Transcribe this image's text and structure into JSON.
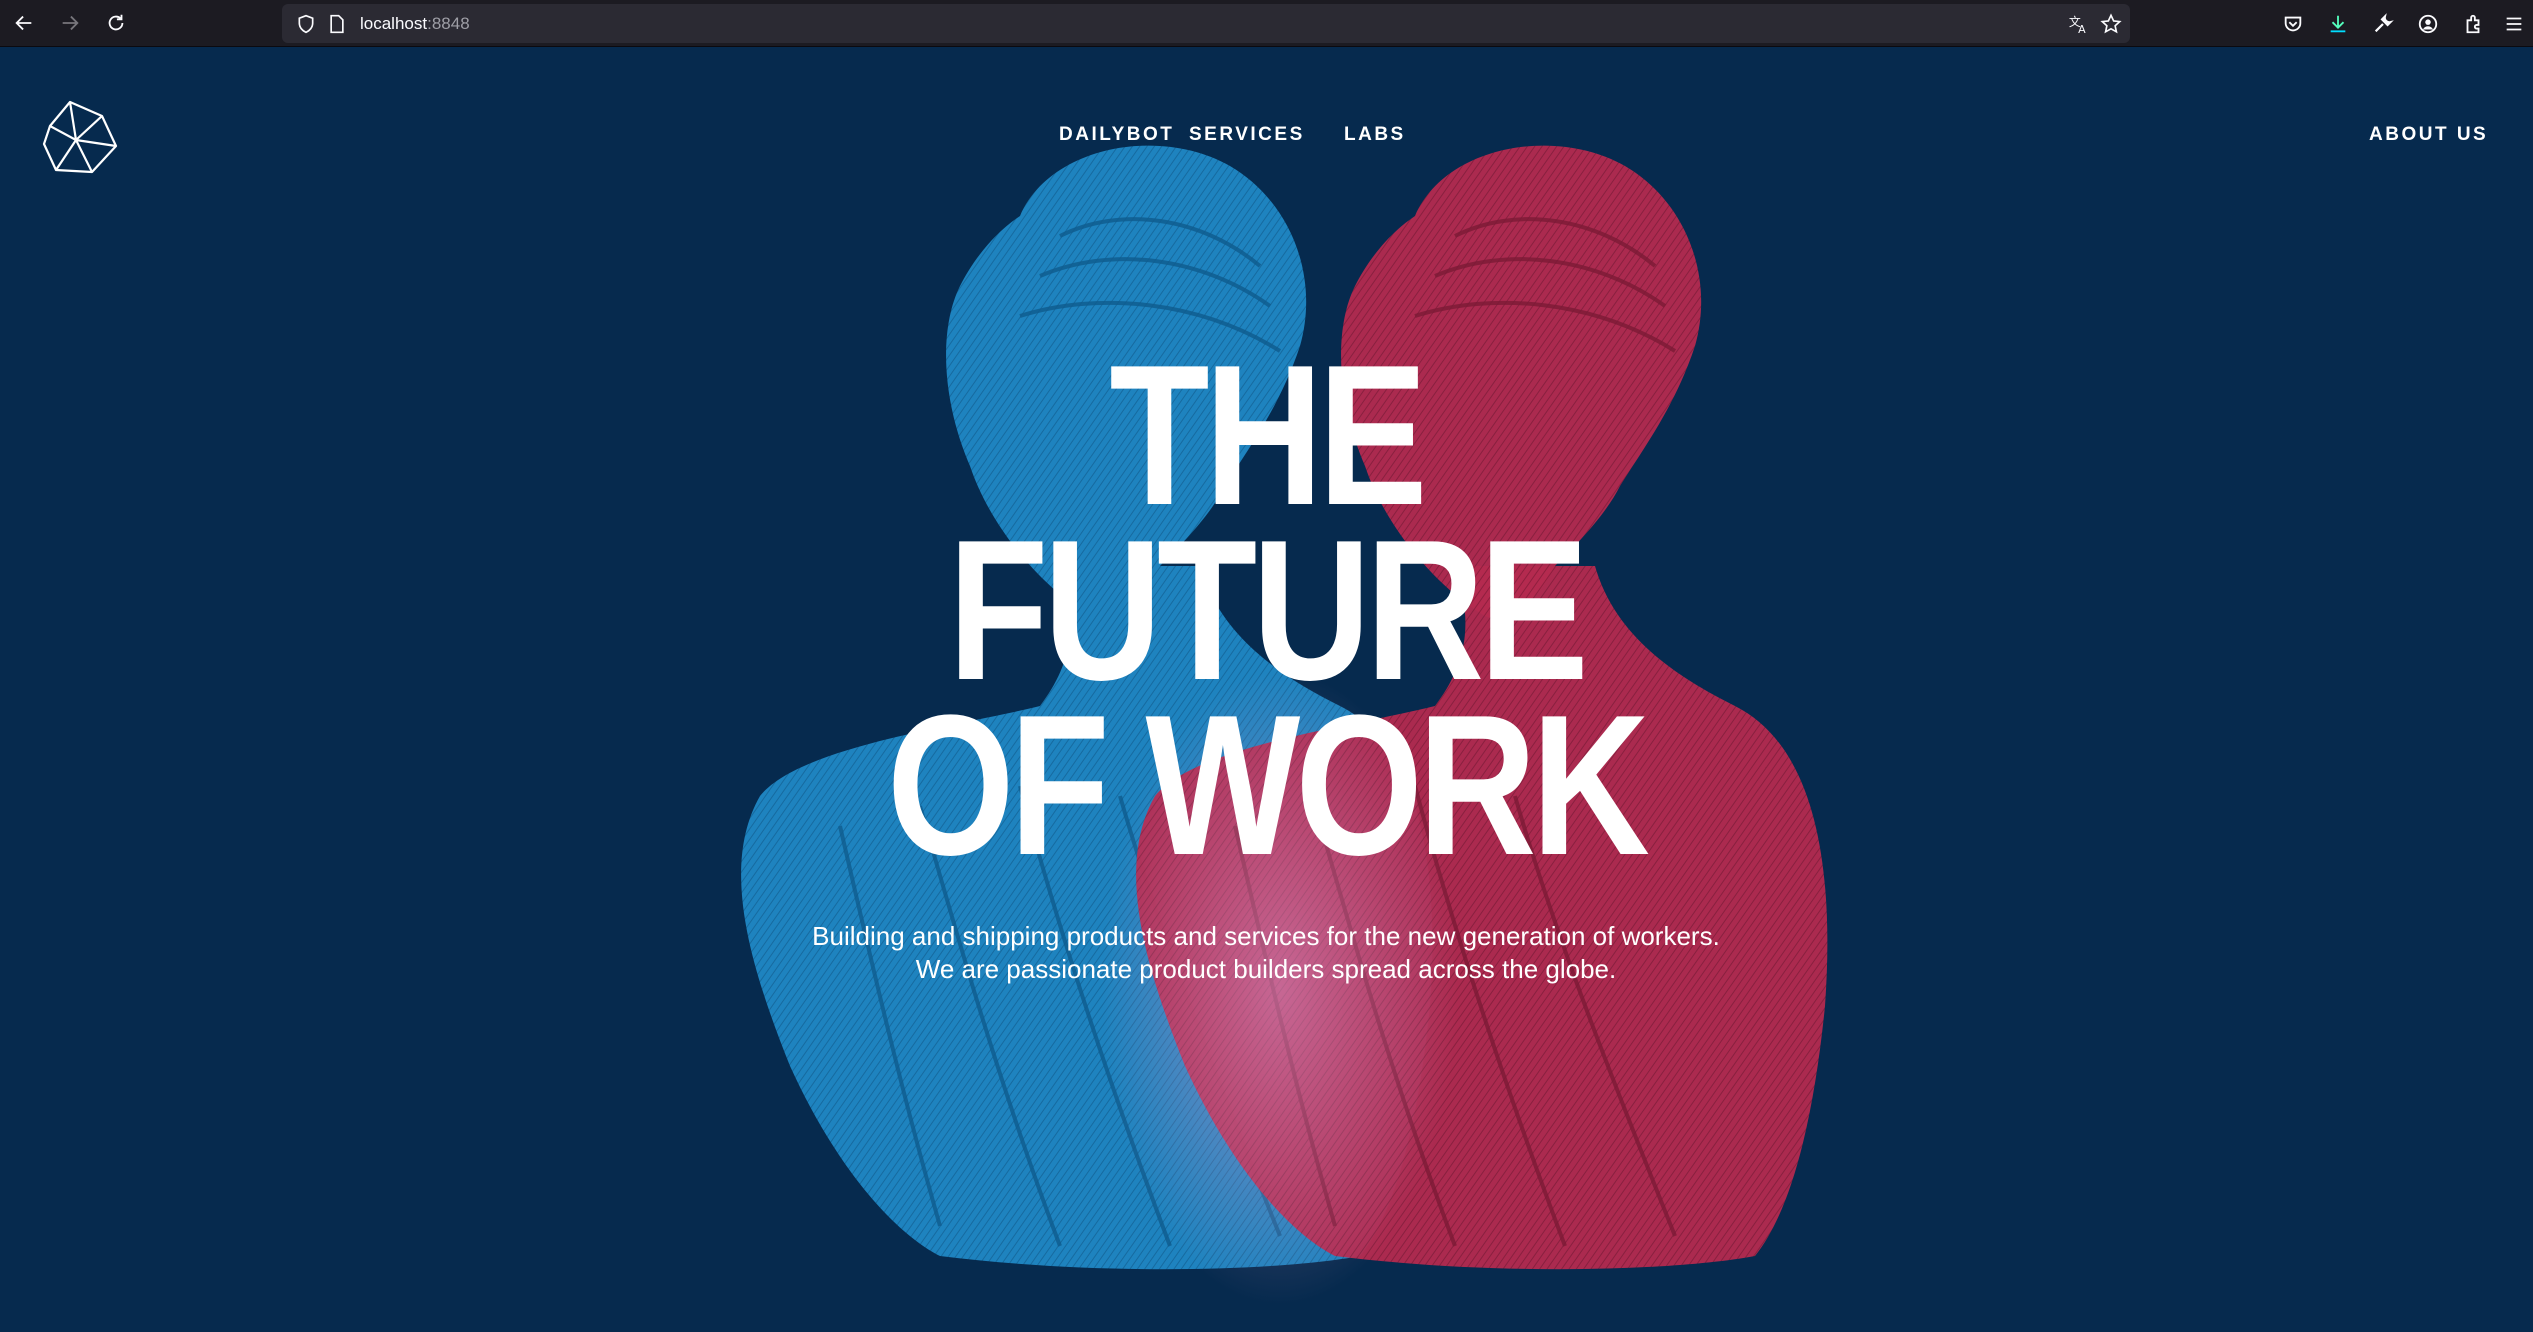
{
  "browser": {
    "url_host": "localhost",
    "url_port": ":8848"
  },
  "nav": {
    "items": [
      {
        "label": "DAILYBOT"
      },
      {
        "label": "SERVICES"
      },
      {
        "label": "LABS"
      }
    ],
    "about": "ABOUT US"
  },
  "hero": {
    "title_lines": [
      "THE",
      "FUTURE",
      "OF WORK"
    ],
    "subtitle_lines": [
      "Building and shipping products and services for the new generation of workers.",
      "We are passionate product builders spread across the globe."
    ]
  },
  "colors": {
    "background": "#062a4e",
    "bust_blue": "#1f86c2",
    "bust_red": "#b3284d",
    "text": "#ffffff"
  },
  "icons": [
    "back-icon",
    "forward-icon",
    "reload-icon",
    "shield-icon",
    "page-icon",
    "translate-icon",
    "star-icon",
    "pocket-icon",
    "download-icon",
    "wrench-icon",
    "account-icon",
    "extensions-icon",
    "menu-icon",
    "logo-icon"
  ]
}
